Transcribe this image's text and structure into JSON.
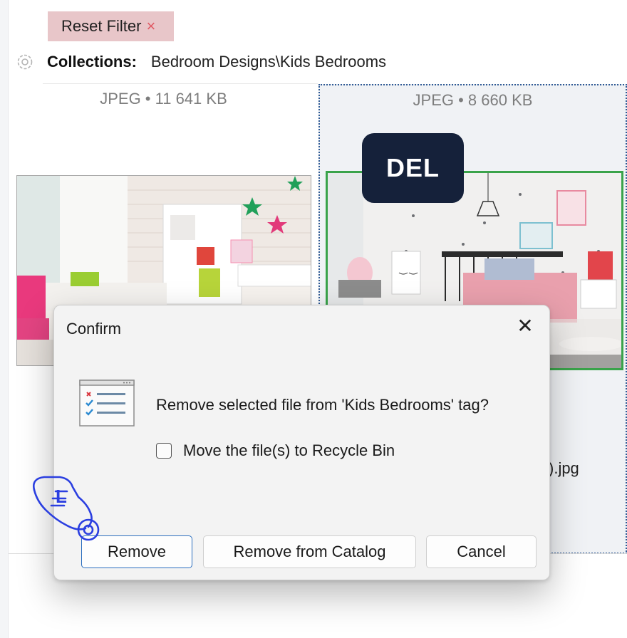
{
  "toolbar": {
    "reset_filter_label": "Reset Filter",
    "reset_filter_x": "×"
  },
  "collections": {
    "label": "Collections:",
    "value": "Bedroom Designs\\Kids Bedrooms"
  },
  "files": [
    {
      "meta": "JPEG • 11 641 KB"
    },
    {
      "meta": "JPEG • 8 660 KB",
      "filename_fragment": ").jpg",
      "selected": true
    }
  ],
  "key_badge": "DEL",
  "dialog": {
    "title": "Confirm",
    "close_glyph": "✕",
    "message": "Remove selected file from 'Kids Bedrooms' tag?",
    "checkbox_label": "Move the file(s) to Recycle Bin",
    "checkbox_checked": false,
    "buttons": {
      "remove": "Remove",
      "remove_catalog": "Remove from Catalog",
      "cancel": "Cancel"
    }
  },
  "pointer_letter": "L",
  "colors": {
    "selection_green": "#3aa34a",
    "selection_dotted": "#2f5a95",
    "badge_bg": "#15213a",
    "reset_bg": "#e8c6c9",
    "reset_x": "#e05a64",
    "hand": "#2b3fe0"
  },
  "icons": [
    "gear-icon",
    "close-icon",
    "checklist-icon",
    "pointing-hand-icon"
  ]
}
